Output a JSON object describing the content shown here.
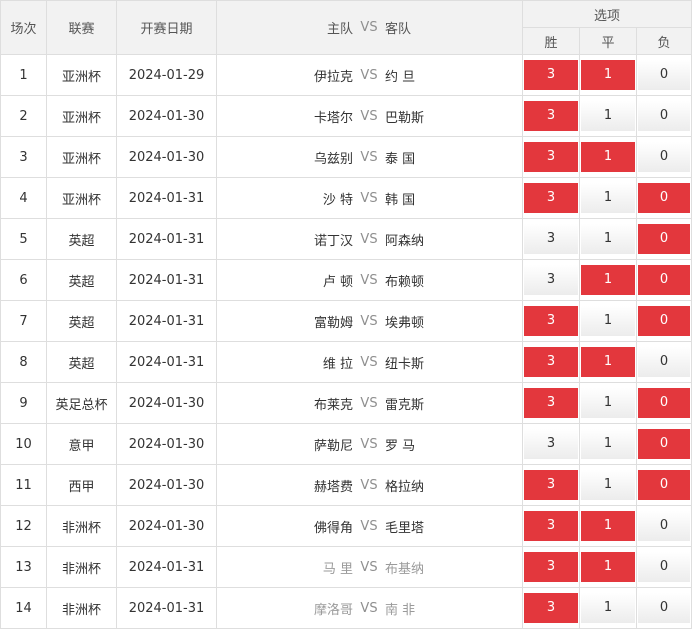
{
  "header": {
    "col_index": "场次",
    "col_league": "联赛",
    "col_date": "开赛日期",
    "col_home": "主队",
    "col_vs": "VS",
    "col_away": "客队",
    "col_options": "选项",
    "opt_win": "胜",
    "opt_draw": "平",
    "opt_lose": "负"
  },
  "colors": {
    "selected": "#e3373d",
    "border": "#dedede",
    "header_bg": "#f2f2f2"
  },
  "rows": [
    {
      "idx": "1",
      "league": "亚洲杯",
      "date": "2024-01-29",
      "home": "伊拉克",
      "vs": "VS",
      "away": "约 旦",
      "muted": false,
      "win": "3",
      "draw": "1",
      "lose": "0",
      "win_sel": true,
      "draw_sel": true,
      "lose_sel": false
    },
    {
      "idx": "2",
      "league": "亚洲杯",
      "date": "2024-01-30",
      "home": "卡塔尔",
      "vs": "VS",
      "away": "巴勒斯",
      "muted": false,
      "win": "3",
      "draw": "1",
      "lose": "0",
      "win_sel": true,
      "draw_sel": false,
      "lose_sel": false
    },
    {
      "idx": "3",
      "league": "亚洲杯",
      "date": "2024-01-30",
      "home": "乌兹别",
      "vs": "VS",
      "away": "泰 国",
      "muted": false,
      "win": "3",
      "draw": "1",
      "lose": "0",
      "win_sel": true,
      "draw_sel": true,
      "lose_sel": false
    },
    {
      "idx": "4",
      "league": "亚洲杯",
      "date": "2024-01-31",
      "home": "沙 特",
      "vs": "VS",
      "away": "韩 国",
      "muted": false,
      "win": "3",
      "draw": "1",
      "lose": "0",
      "win_sel": true,
      "draw_sel": false,
      "lose_sel": true
    },
    {
      "idx": "5",
      "league": "英超",
      "date": "2024-01-31",
      "home": "诺丁汉",
      "vs": "VS",
      "away": "阿森纳",
      "muted": false,
      "win": "3",
      "draw": "1",
      "lose": "0",
      "win_sel": false,
      "draw_sel": false,
      "lose_sel": true
    },
    {
      "idx": "6",
      "league": "英超",
      "date": "2024-01-31",
      "home": "卢 顿",
      "vs": "VS",
      "away": "布赖顿",
      "muted": false,
      "win": "3",
      "draw": "1",
      "lose": "0",
      "win_sel": false,
      "draw_sel": true,
      "lose_sel": true
    },
    {
      "idx": "7",
      "league": "英超",
      "date": "2024-01-31",
      "home": "富勒姆",
      "vs": "VS",
      "away": "埃弗顿",
      "muted": false,
      "win": "3",
      "draw": "1",
      "lose": "0",
      "win_sel": true,
      "draw_sel": false,
      "lose_sel": true
    },
    {
      "idx": "8",
      "league": "英超",
      "date": "2024-01-31",
      "home": "维 拉",
      "vs": "VS",
      "away": "纽卡斯",
      "muted": false,
      "win": "3",
      "draw": "1",
      "lose": "0",
      "win_sel": true,
      "draw_sel": true,
      "lose_sel": false
    },
    {
      "idx": "9",
      "league": "英足总杯",
      "date": "2024-01-30",
      "home": "布莱克",
      "vs": "VS",
      "away": "雷克斯",
      "muted": false,
      "win": "3",
      "draw": "1",
      "lose": "0",
      "win_sel": true,
      "draw_sel": false,
      "lose_sel": true
    },
    {
      "idx": "10",
      "league": "意甲",
      "date": "2024-01-30",
      "home": "萨勒尼",
      "vs": "VS",
      "away": "罗 马",
      "muted": false,
      "win": "3",
      "draw": "1",
      "lose": "0",
      "win_sel": false,
      "draw_sel": false,
      "lose_sel": true
    },
    {
      "idx": "11",
      "league": "西甲",
      "date": "2024-01-30",
      "home": "赫塔费",
      "vs": "VS",
      "away": "格拉纳",
      "muted": false,
      "win": "3",
      "draw": "1",
      "lose": "0",
      "win_sel": true,
      "draw_sel": false,
      "lose_sel": true
    },
    {
      "idx": "12",
      "league": "非洲杯",
      "date": "2024-01-30",
      "home": "佛得角",
      "vs": "VS",
      "away": "毛里塔",
      "muted": false,
      "win": "3",
      "draw": "1",
      "lose": "0",
      "win_sel": true,
      "draw_sel": true,
      "lose_sel": false
    },
    {
      "idx": "13",
      "league": "非洲杯",
      "date": "2024-01-31",
      "home": "马 里",
      "vs": "VS",
      "away": "布基纳",
      "muted": true,
      "win": "3",
      "draw": "1",
      "lose": "0",
      "win_sel": true,
      "draw_sel": true,
      "lose_sel": false
    },
    {
      "idx": "14",
      "league": "非洲杯",
      "date": "2024-01-31",
      "home": "摩洛哥",
      "vs": "VS",
      "away": "南 非",
      "muted": true,
      "win": "3",
      "draw": "1",
      "lose": "0",
      "win_sel": true,
      "draw_sel": false,
      "lose_sel": false
    }
  ]
}
